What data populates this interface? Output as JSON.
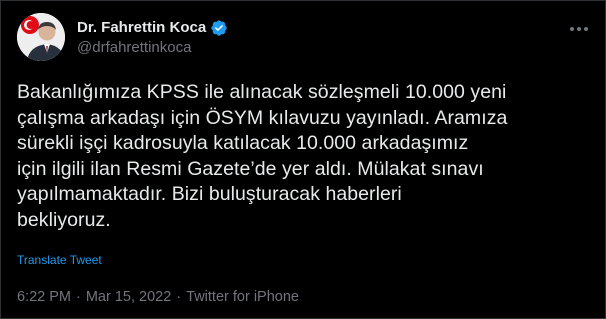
{
  "author": {
    "display_name": "Dr. Fahrettin Koca",
    "handle": "@drfahrettinkoca",
    "verified": true
  },
  "tweet": {
    "lines": [
      "Bakanlığımıza KPSS ile alınacak sözleşmeli 10.000 yeni",
      "çalışma arkadaşı için ÖSYM kılavuzu yayınladı. Aramıza",
      "sürekli işçi kadrosuyla katılacak 10.000 arkadaşımız",
      "için ilgili ilan Resmi Gazete’de yer aldı. Mülakat sınavı",
      "yapılmamaktadır. Bizi buluşturacak haberleri",
      "bekliyoruz."
    ],
    "translate_label": "Translate Tweet"
  },
  "meta": {
    "time": "6:22 PM",
    "separator": "·",
    "date": "Mar 15, 2022",
    "source": "Twitter for iPhone"
  },
  "colors": {
    "background": "#000000",
    "text": "#e7e9ea",
    "secondary": "#71767b",
    "accent": "#1d9bf0",
    "verified_badge": "#1d9bf0"
  },
  "icons": {
    "avatar": "profile-photo",
    "verified": "verified-badge-icon",
    "more": "more-options-icon"
  }
}
